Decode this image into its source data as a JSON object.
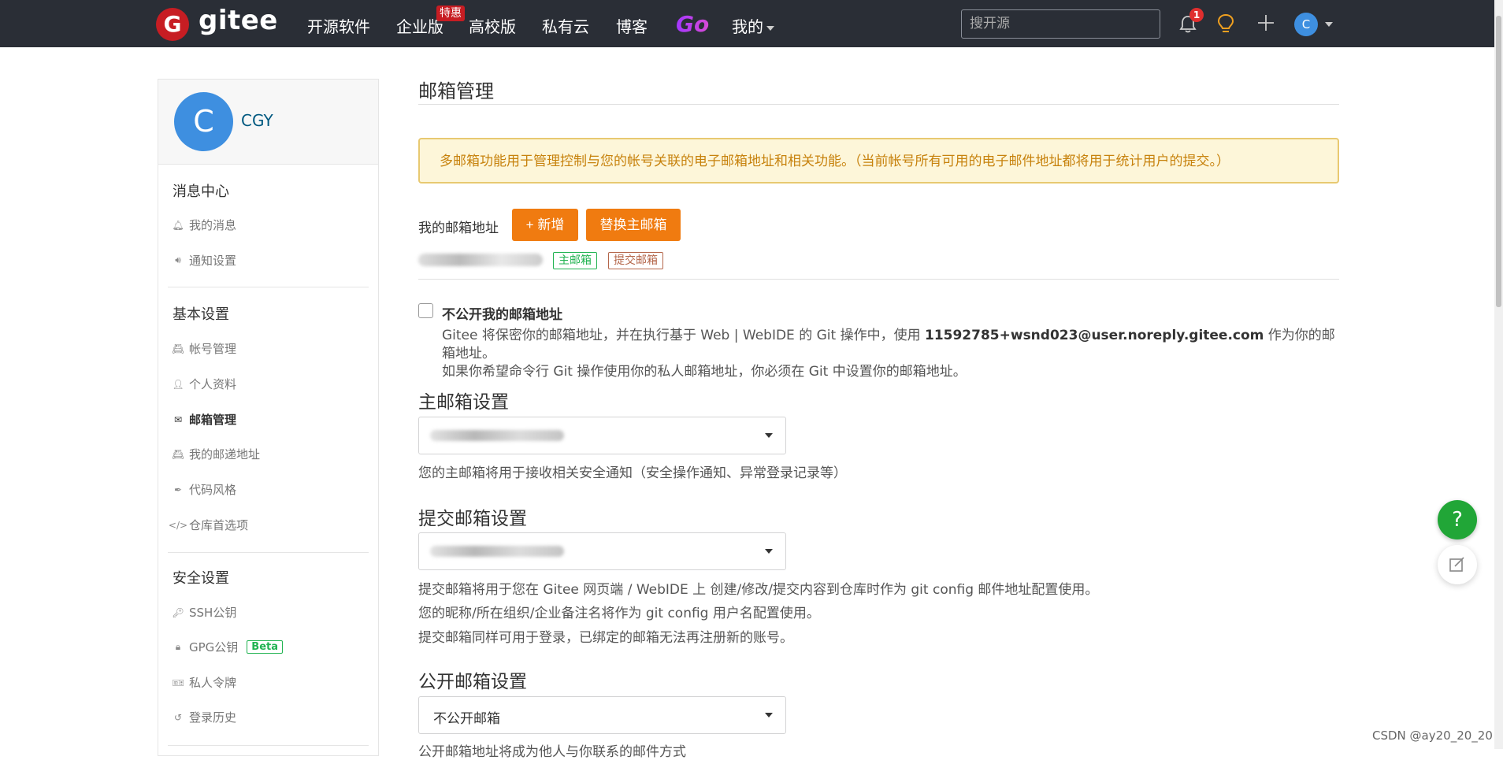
{
  "topnav": {
    "logo_letter": "G",
    "logo_text": "gitee",
    "items": [
      "开源软件",
      "企业版",
      "高校版",
      "私有云",
      "博客"
    ],
    "go_label": "Go",
    "mine_label": "我的",
    "hot_badge": "特惠",
    "search_placeholder": "搜开源",
    "notif_count": "1",
    "avatar_letter": "C"
  },
  "sidebar": {
    "avatar_letter": "C",
    "username": "CGY",
    "sections": [
      {
        "title": "消息中心",
        "items": [
          "我的消息",
          "通知设置"
        ]
      },
      {
        "title": "基本设置",
        "items": [
          "帐号管理",
          "个人资料",
          "邮箱管理",
          "我的邮递地址",
          "代码风格",
          "仓库首选项"
        ]
      },
      {
        "title": "安全设置",
        "items": [
          "SSH公钥",
          "GPG公钥",
          "私人令牌",
          "登录历史"
        ]
      }
    ],
    "beta_label": "Beta"
  },
  "main": {
    "title": "邮箱管理",
    "notice": "多邮箱功能用于管理控制与您的帐号关联的电子邮箱地址和相关功能。（当前帐号所有可用的电子邮件地址都将用于统计用户的提交。）",
    "my_email_label": "我的邮箱地址",
    "add_button": "+ 新增",
    "replace_button": "替换主邮箱",
    "tag_primary": "主邮箱",
    "tag_commit": "提交邮箱",
    "private_label": "不公开我的邮箱地址",
    "private_desc_1a": "Gitee 将保密你的邮箱地址，并在执行基于 Web | WebIDE 的 Git 操作中，使用 ",
    "private_desc_email": "11592785+wsnd023@user.noreply.gitee.com",
    "private_desc_1b": " 作为你的邮箱地址。",
    "private_desc_2": "如果你希望命令行 Git 操作使用你的私人邮箱地址，你必须在 Git 中设置你的邮箱地址。",
    "primary_title": "主邮箱设置",
    "primary_help": "您的主邮箱将用于接收相关安全通知（安全操作通知、异常登录记录等）",
    "commit_title": "提交邮箱设置",
    "commit_help_1": "提交邮箱将用于您在 Gitee 网页端 / WebIDE 上 创建/修改/提交内容到仓库时作为 git config 邮件地址配置使用。",
    "commit_help_2": "您的昵称/所在组织/企业备注名将作为 git config 用户名配置使用。",
    "commit_help_3": "提交邮箱同样可用于登录，已绑定的邮箱无法再注册新的账号。",
    "public_title": "公开邮箱设置",
    "public_value": "不公开邮箱",
    "public_help": "公开邮箱地址将成为他人与你联系的邮件方式"
  },
  "floating": {
    "help_label": "?"
  },
  "watermark": "CSDN @ay20_20_20"
}
